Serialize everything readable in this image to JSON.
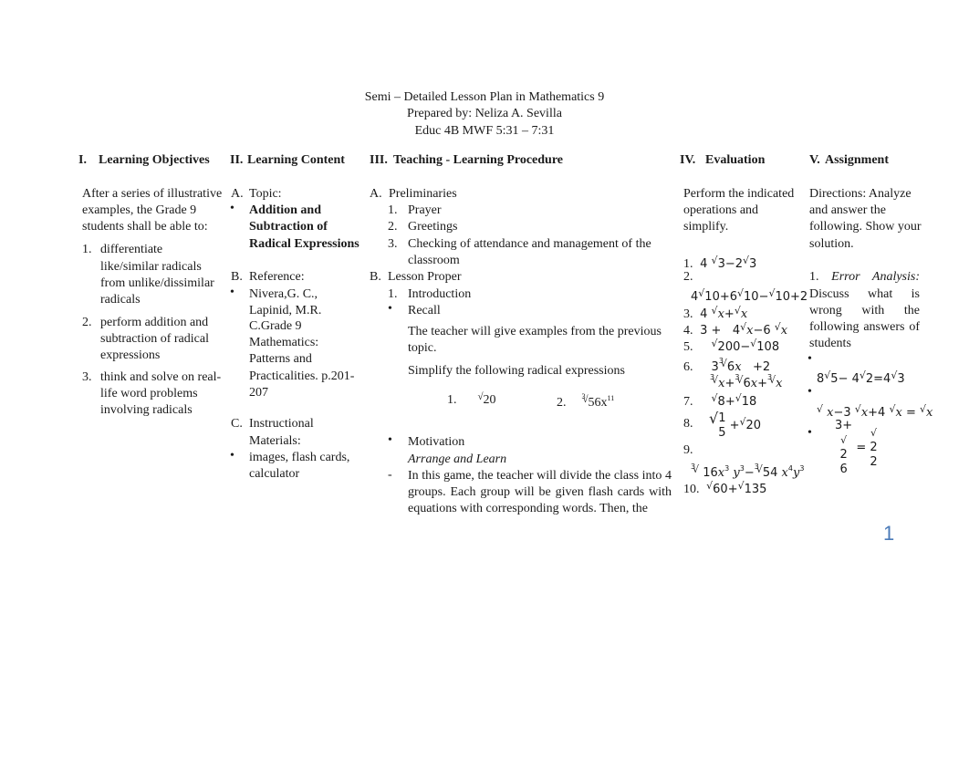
{
  "header": {
    "title": "Semi – Detailed Lesson Plan in Mathematics 9",
    "prepared_by": "Prepared by: Neliza A. Sevilla",
    "class_info": "Educ 4B MWF 5:31 – 7:31"
  },
  "columns": {
    "objectives": {
      "numeral": "I.",
      "title": "Learning Objectives",
      "intro": [
        "After a series of illustrative",
        "examples, the Grade 9",
        "students shall be able to:"
      ],
      "items": [
        {
          "num": "1.",
          "lines": [
            "differentiate",
            "like/similar radicals",
            "from unlike/dissimilar",
            "radicals"
          ]
        },
        {
          "num": "2.",
          "lines": [
            "perform addition and",
            "subtraction of radical",
            "expressions"
          ]
        },
        {
          "num": "3.",
          "lines": [
            "think and solve on real-",
            "life word problems",
            "involving radicals"
          ]
        }
      ]
    },
    "content": {
      "numeral": "II.",
      "title": "Learning Content",
      "topic_label": "A.",
      "topic_heading": "Topic:",
      "topic_lines": [
        "Addition and",
        "Subtraction of",
        "Radical Expressions"
      ],
      "reference_label": "B.",
      "reference_heading": "Reference:",
      "reference_lines": [
        "Nivera,G. C.,",
        "Lapinid, M.R.",
        "C.Grade 9",
        "Mathematics:",
        "Patterns and",
        "Practicalities. p.201-",
        "207"
      ],
      "materials_label": "C.",
      "materials_heading": [
        "Instructional",
        "Materials:"
      ],
      "materials_lines": [
        "images, flash cards,",
        "calculator"
      ]
    },
    "procedure": {
      "numeral": "III.",
      "title": "Teaching - Learning Procedure",
      "a_label": "A.",
      "a_heading": "Preliminaries",
      "prelim": [
        {
          "num": "1.",
          "text": "Prayer"
        },
        {
          "num": "2.",
          "text": "Greetings"
        },
        {
          "num": "3.",
          "text": "Checking of attendance and management of the",
          "cont": "classroom"
        }
      ],
      "b_label": "B.",
      "b_heading": "Lesson Proper",
      "intro_num": "1.",
      "intro_label": "Introduction",
      "recall_label": "Recall",
      "recall_text": [
        "The teacher will give examples from the previous",
        "topic."
      ],
      "simplify_text": "Simplify the following radical expressions",
      "recall_examples": [
        {
          "num": "1.",
          "radicand": "20",
          "index": ""
        },
        {
          "num": "2.",
          "radicand": "56x",
          "exponent": "11",
          "index": "3"
        }
      ],
      "motivation_label": "Motivation",
      "game_title": "Arrange and Learn",
      "game_dash": "-",
      "game_text": "In this game, the teacher will divide the class into 4 groups. Each group will be given flash cards with equations with corresponding words. Then, the"
    },
    "evaluation": {
      "numeral": "IV.",
      "title": "Evaluation",
      "intro": [
        "Perform the indicated",
        "operations and",
        "simplify."
      ],
      "items": [
        {
          "num": "1.",
          "expr": "4√3 − 2√3"
        },
        {
          "num": "2.",
          "expr": "4√10 + 6√10 − √10 + 2"
        },
        {
          "num": "3.",
          "expr": "4√x + √x"
        },
        {
          "num": "4.",
          "expr": "3 + 4√x − 6√x"
        },
        {
          "num": "5.",
          "expr": "√200 − √108"
        },
        {
          "num": "6.",
          "expr": "3∛6x + 2∛x + ∛6x + ∛x"
        },
        {
          "num": "7.",
          "expr": "√8 + √18"
        },
        {
          "num": "8.",
          "expr": "√(1/5) + √20"
        },
        {
          "num": "9.",
          "expr": "∛16x³y³ − ∛54x⁴y³"
        },
        {
          "num": "10.",
          "expr": "√60 + √135"
        }
      ]
    },
    "assignment": {
      "numeral": "V.",
      "title": "Assignment",
      "intro": [
        "Directions: Analyze",
        "and answer the",
        "following. Show your",
        "solution."
      ],
      "task_num": "1.",
      "task_title": "Error Analysis:",
      "task_text": "Discuss what is wrong with the following answers of students",
      "answers": [
        "8√5 − 4√2 = 4√3",
        "√x − 3√x + 4√x = √x",
        "(3 + √2)/6 = √2/2"
      ]
    }
  },
  "page_number": "1"
}
